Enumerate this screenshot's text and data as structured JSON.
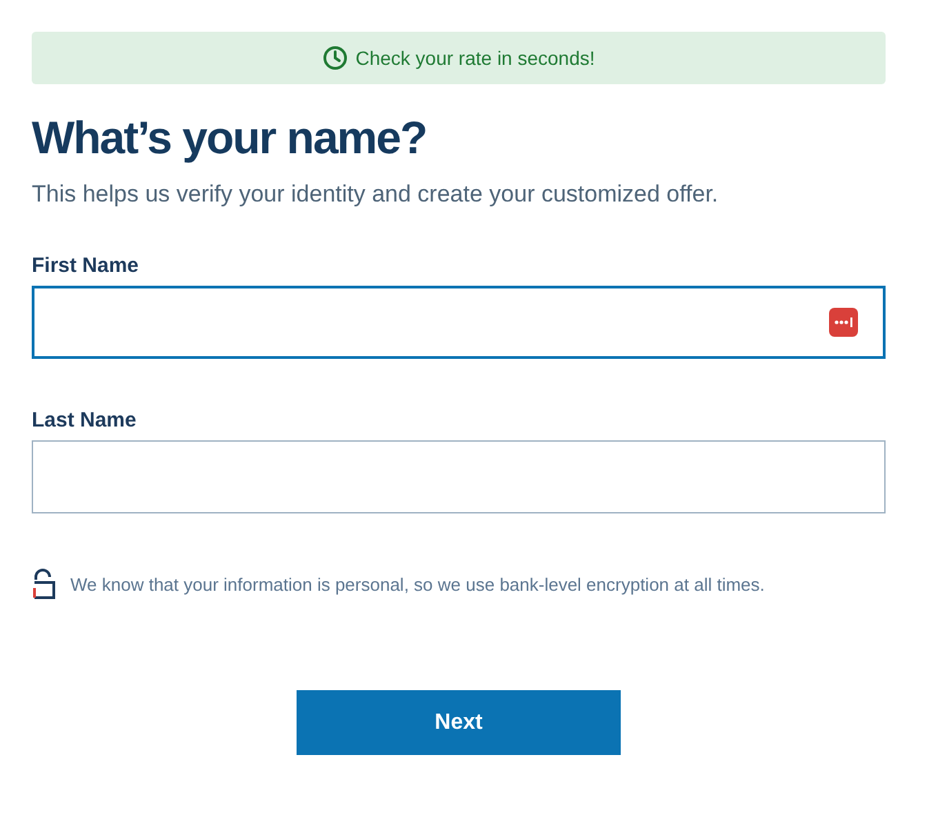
{
  "banner": {
    "text": "Check your rate in seconds!"
  },
  "heading": "What’s your name?",
  "subtitle": "This helps us verify your identity and create your customized offer.",
  "fields": [
    {
      "label": "First Name",
      "focused": true,
      "password_manager_icon": true
    },
    {
      "label": "Last Name",
      "focused": false,
      "password_manager_icon": false
    }
  ],
  "security_note": "We know that your information is personal, so we use bank-level encryption at all times.",
  "button": "Next"
}
